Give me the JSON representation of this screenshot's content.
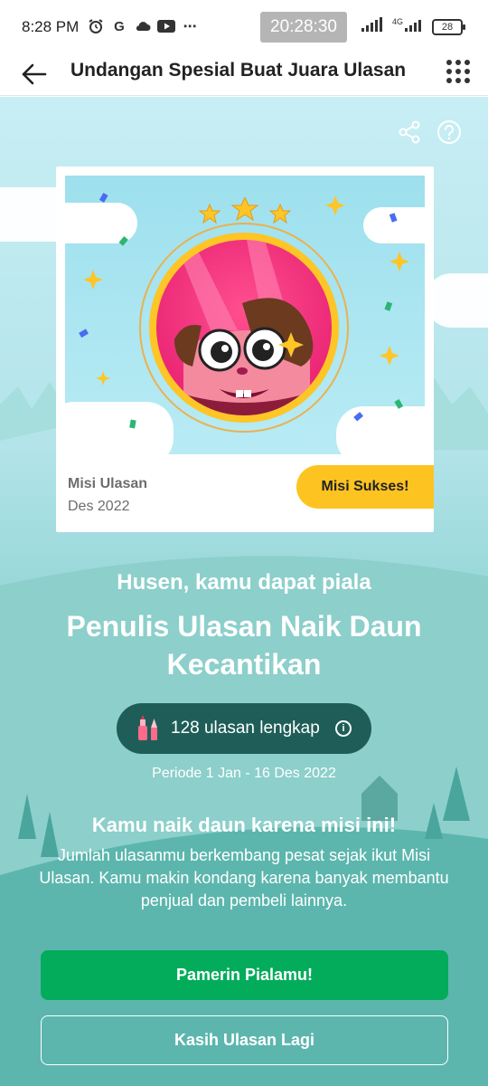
{
  "status_bar": {
    "time": "8:28 PM",
    "clock_badge": "20:28:30",
    "network": "4G",
    "battery": "28"
  },
  "header": {
    "title": "Undangan Spesial Buat Juara Ulasan"
  },
  "card": {
    "mission_label": "Misi Ulasan",
    "mission_date": "Des 2022",
    "success_badge": "Misi Sukses!"
  },
  "congrats": {
    "subhead": "Husen, kamu dapat piala",
    "trophy_title": "Penulis Ulasan Naik Daun Kecantikan"
  },
  "stats": {
    "review_count_text": "128 ulasan lengkap",
    "period": "Periode 1 Jan - 16 Des 2022"
  },
  "mission": {
    "title": "Kamu naik daun karena misi ini!",
    "description": "Jumlah ulasanmu berkembang pesat sejak ikut Misi Ulasan. Kamu makin kondang karena banyak membantu penjual dan pembeli lainnya."
  },
  "actions": {
    "primary_label": "Pamerin Pialamu!",
    "secondary_label": "Kasih Ulasan Lagi"
  },
  "colors": {
    "primary_green": "#03ac5b",
    "badge_yellow": "#fdc321",
    "pill_bg": "#1f5e58"
  }
}
